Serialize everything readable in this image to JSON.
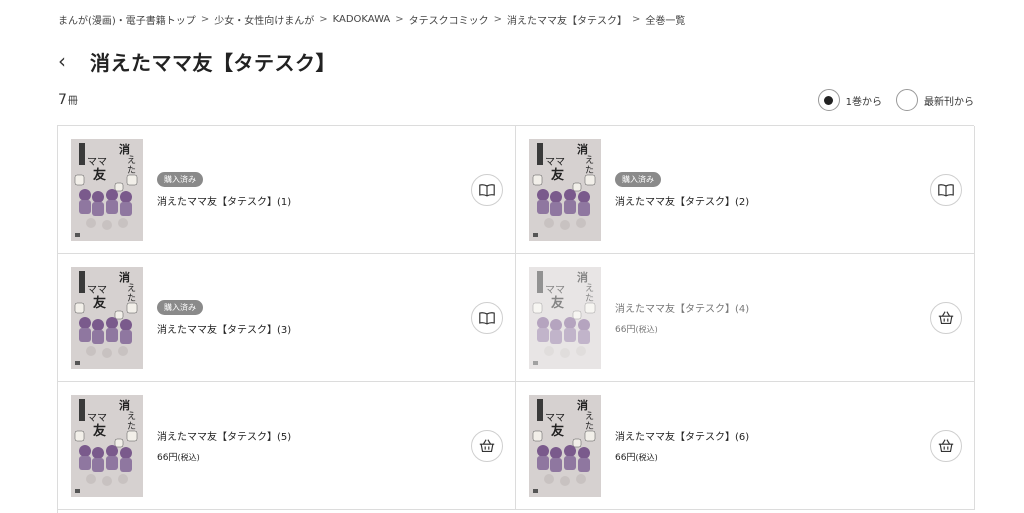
{
  "breadcrumb": {
    "items": [
      "まんが(漫画)・電子書籍トップ",
      "少女・女性向けまんが",
      "KADOKAWA",
      "タテスクコミック",
      "消えたママ友【タテスク】",
      "全巻一覧"
    ],
    "separator": ">"
  },
  "header": {
    "back_icon": "‹",
    "title": "消えたママ友【タテスク】"
  },
  "count": {
    "number": "7",
    "unit": "冊"
  },
  "order": {
    "options": [
      {
        "label": "1巻から",
        "selected": true
      },
      {
        "label": "最新刊から",
        "selected": false
      }
    ]
  },
  "volumes": [
    {
      "title": "消えたママ友【タテスク】(1)",
      "purchased": true,
      "badge": "購入済み",
      "price": "",
      "tax": "",
      "action_icon": "book-icon"
    },
    {
      "title": "消えたママ友【タテスク】(2)",
      "purchased": true,
      "badge": "購入済み",
      "price": "",
      "tax": "",
      "action_icon": "book-icon"
    },
    {
      "title": "消えたママ友【タテスク】(3)",
      "purchased": true,
      "badge": "購入済み",
      "price": "",
      "tax": "",
      "action_icon": "book-icon"
    },
    {
      "title": "消えたママ友【タテスク】(4)",
      "purchased": false,
      "badge": "",
      "price": "66円",
      "tax": "(税込)",
      "action_icon": "basket-icon",
      "dim": true
    },
    {
      "title": "消えたママ友【タテスク】(5)",
      "purchased": false,
      "badge": "",
      "price": "66円",
      "tax": "(税込)",
      "action_icon": "basket-icon"
    },
    {
      "title": "消えたママ友【タテスク】(6)",
      "purchased": false,
      "badge": "",
      "price": "66円",
      "tax": "(税込)",
      "action_icon": "basket-icon"
    }
  ],
  "cover_text": {
    "title_chars": "消えたママ友"
  },
  "colors": {
    "badge": "#8a8a8a",
    "border": "#dcdcdc",
    "cover_purple": "#7a5a8c"
  }
}
